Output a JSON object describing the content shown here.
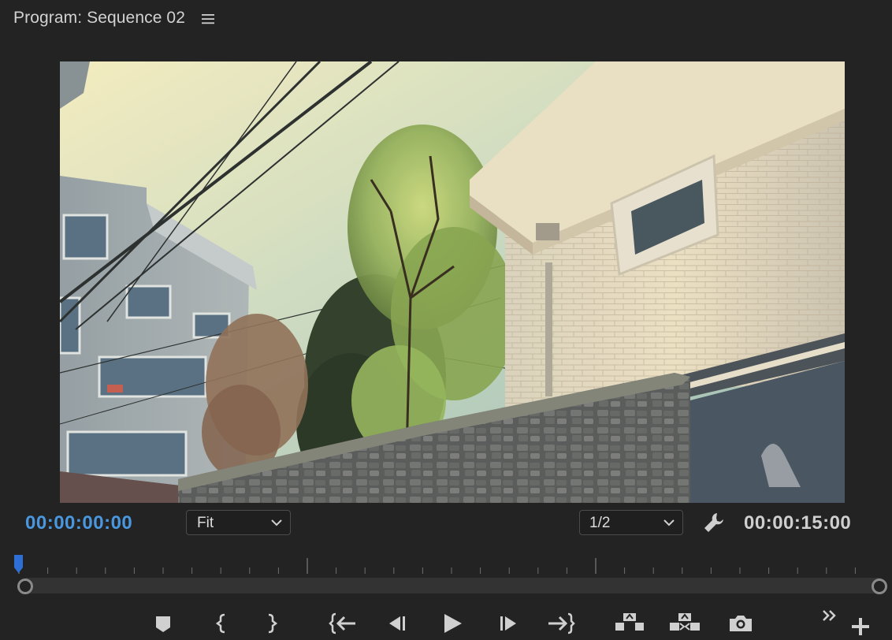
{
  "panel": {
    "title": "Program: Sequence 02",
    "menu_icon": "hamburger-menu-icon"
  },
  "timecode": {
    "current": "00:00:00:00",
    "duration": "00:00:15:00",
    "current_color": "#4a97e0"
  },
  "zoom_dropdown": {
    "value": "Fit"
  },
  "resolution_dropdown": {
    "value": "1/2"
  },
  "settings_icon": "wrench-icon",
  "playhead_color": "#2e6fd6",
  "transport": {
    "buttons": [
      {
        "name": "add-marker-button",
        "icon": "marker-icon"
      },
      {
        "name": "mark-in-button",
        "icon": "mark-in-icon"
      },
      {
        "name": "mark-out-button",
        "icon": "mark-out-icon"
      },
      {
        "name": "go-to-in-button",
        "icon": "go-to-in-icon"
      },
      {
        "name": "step-back-button",
        "icon": "step-back-icon"
      },
      {
        "name": "play-button",
        "icon": "play-icon"
      },
      {
        "name": "step-forward-button",
        "icon": "step-forward-icon"
      },
      {
        "name": "go-to-out-button",
        "icon": "go-to-out-icon"
      },
      {
        "name": "lift-button",
        "icon": "lift-icon"
      },
      {
        "name": "extract-button",
        "icon": "extract-icon"
      },
      {
        "name": "export-frame-button",
        "icon": "camera-icon"
      },
      {
        "name": "more-controls-button",
        "icon": "double-chevron-right-icon"
      },
      {
        "name": "button-editor-button",
        "icon": "plus-icon"
      }
    ]
  }
}
